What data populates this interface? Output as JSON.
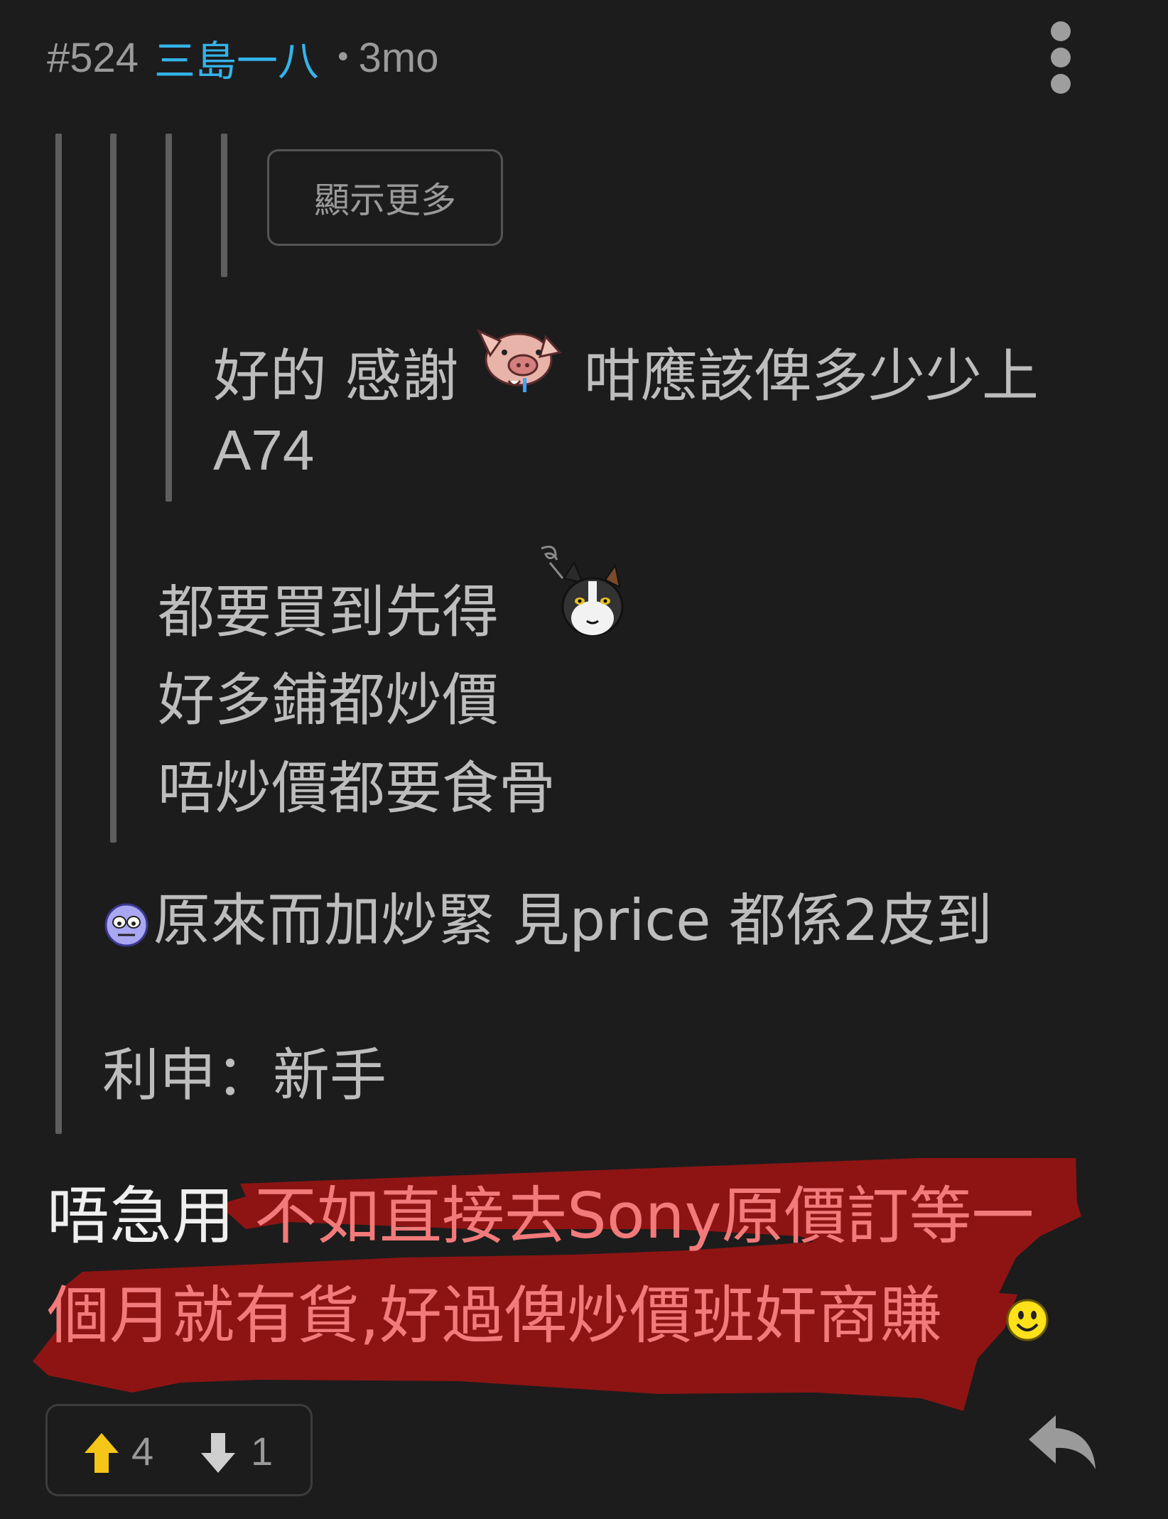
{
  "header": {
    "post_number": "#524",
    "author": "三島一八",
    "separator": "•",
    "time": "3mo",
    "menu_icon": "more-vertical-icon"
  },
  "quotes": {
    "show_more_label": "顯示更多",
    "level3": {
      "line1_a": "好的 感謝",
      "line1_b": "咁應該俾多少少上",
      "line2": "A74",
      "emoji": "pig-emoji"
    },
    "level2": {
      "line1": "都要買到先得",
      "line2": "好多鋪都炒價",
      "line3": "唔炒價都要食骨",
      "emoji": "cat-emoji"
    },
    "level1": {
      "line1": "原來而加炒緊 見price 都係2皮到",
      "line2": "利申：新手",
      "emoji": "dizzy-face-emoji"
    }
  },
  "reply": {
    "line1_plain": "唔急用",
    "line1_highlight": "不如直接去Sony原價訂等一",
    "line2_highlight": "個月就有貨,好過俾炒價班奸商賺",
    "trailing_emoji": "smiley-icon",
    "highlight_color": "#8e1414"
  },
  "footer": {
    "upvote_icon": "arrow-up-icon",
    "upvote_count": "4",
    "downvote_icon": "arrow-down-icon",
    "downvote_count": "1",
    "reply_icon": "reply-icon"
  },
  "colors": {
    "background": "#1c1c1c",
    "author": "#34b3ea",
    "upvote": "#f5c518"
  }
}
